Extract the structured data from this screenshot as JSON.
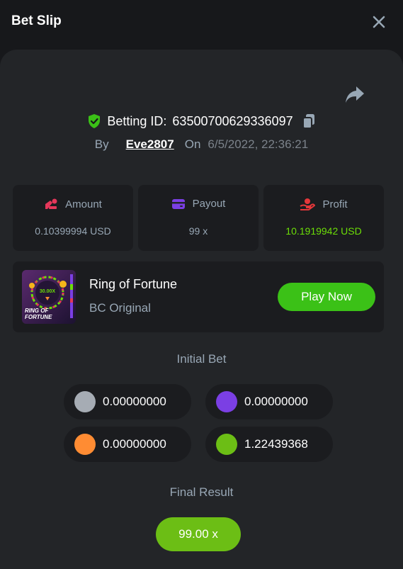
{
  "header": {
    "title": "Bet Slip"
  },
  "bet": {
    "betting_id_label": "Betting ID:",
    "betting_id": "63500700629336097",
    "by_label": "By",
    "user": "Eve2807",
    "on_label": "On",
    "date": "6/5/2022, 22:36:21"
  },
  "stats": {
    "amount": {
      "label": "Amount",
      "value": "0.10399994 USD",
      "icon": "coins-icon",
      "color": "#e5375a"
    },
    "payout": {
      "label": "Payout",
      "value": "99 x",
      "icon": "wallet-icon",
      "color": "#7b3fe4"
    },
    "profit": {
      "label": "Profit",
      "value": "10.1919942 USD",
      "icon": "hand-coin-icon",
      "color": "#e5373a"
    }
  },
  "game": {
    "name": "Ring of Fortune",
    "provider": "BC Original",
    "play_label": "Play Now",
    "thumb_multiplier": "30.00X",
    "thumb_title_line1": "RING OF",
    "thumb_title_line2": "FORTUNE"
  },
  "initial_bet": {
    "label": "Initial Bet",
    "slots": [
      {
        "value": "0.00000000",
        "color": "#a6acb4"
      },
      {
        "value": "0.00000000",
        "color": "#7b3fe4"
      },
      {
        "value": "0.00000000",
        "color": "#ff8c33"
      },
      {
        "value": "1.22439368",
        "color": "#6cbe15"
      }
    ]
  },
  "final_result": {
    "label": "Final Result",
    "value": "99.00 x"
  },
  "colors": {
    "accent": "#3bc117",
    "profit": "#6cde07",
    "panel": "#232528",
    "card": "#1b1c1f"
  }
}
